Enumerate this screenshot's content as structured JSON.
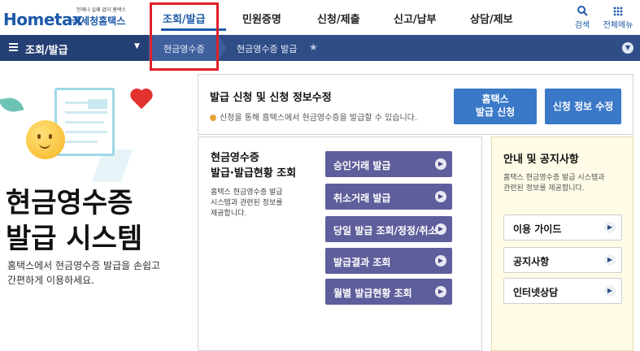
{
  "header": {
    "logo_main": "Hometax",
    "logo_small": "언제나 실패 없이 홈택스",
    "logo_sub": "국세청홈택스",
    "nav": [
      "조회/발급",
      "민원증명",
      "신청/제출",
      "신고/납부",
      "상담/제보"
    ],
    "search_label": "검색",
    "menu_label": "전체메뉴"
  },
  "subnav": {
    "section": "조회/발급",
    "crumb_1": "현금영수증",
    "crumb_2": "현금영수증 발급"
  },
  "hero": {
    "title_line1": "현금영수증",
    "title_line2": "발급 시스템",
    "desc_line1": "홈택스에서 현금영수증 발급을 손쉽고",
    "desc_line2": "간편하게 이용하세요."
  },
  "issue_panel": {
    "title": "발급 신청 및 신청 정보수정",
    "note": "신청을 통해 홈택스에서 현금영수증을 발급할 수 있습니다.",
    "apply_line1": "홈택스",
    "apply_line2": "발급 신청",
    "edit_label": "신청 정보 수정"
  },
  "inquiry_panel": {
    "title_line1": "현금영수증",
    "title_line2": "발급·발급현황 조회",
    "desc_line1": "홈택스 현금영수증 발급",
    "desc_line2": "시스템과 관련된 정보를",
    "desc_line3": "제공합니다.",
    "buttons": [
      "승인거래 발급",
      "취소거래 발급",
      "당일 발급 조회/정정/취소",
      "발급결과 조회",
      "월별 발급현황 조회"
    ]
  },
  "notice_panel": {
    "title": "안내 및 공지사항",
    "desc_line1": "홈택스 현금영수증 발급 시스템과",
    "desc_line2": "관련된 정보를 제공합니다.",
    "buttons": [
      "이용 가이드",
      "공지사항",
      "인터넷상담"
    ]
  },
  "colors": {
    "brand_blue": "#1d5aa8",
    "subnav_bg": "#2f4d86",
    "action_blue": "#3a78c8",
    "purple_button": "#5f5e9c",
    "highlight_red": "#e0202a",
    "notice_bg": "#fffbe6"
  },
  "icons": [
    "search-icon",
    "grid-menu-icon",
    "hamburger-icon",
    "chevron-down-icon",
    "star-icon",
    "arrow-right-icon",
    "info-dot-icon"
  ]
}
